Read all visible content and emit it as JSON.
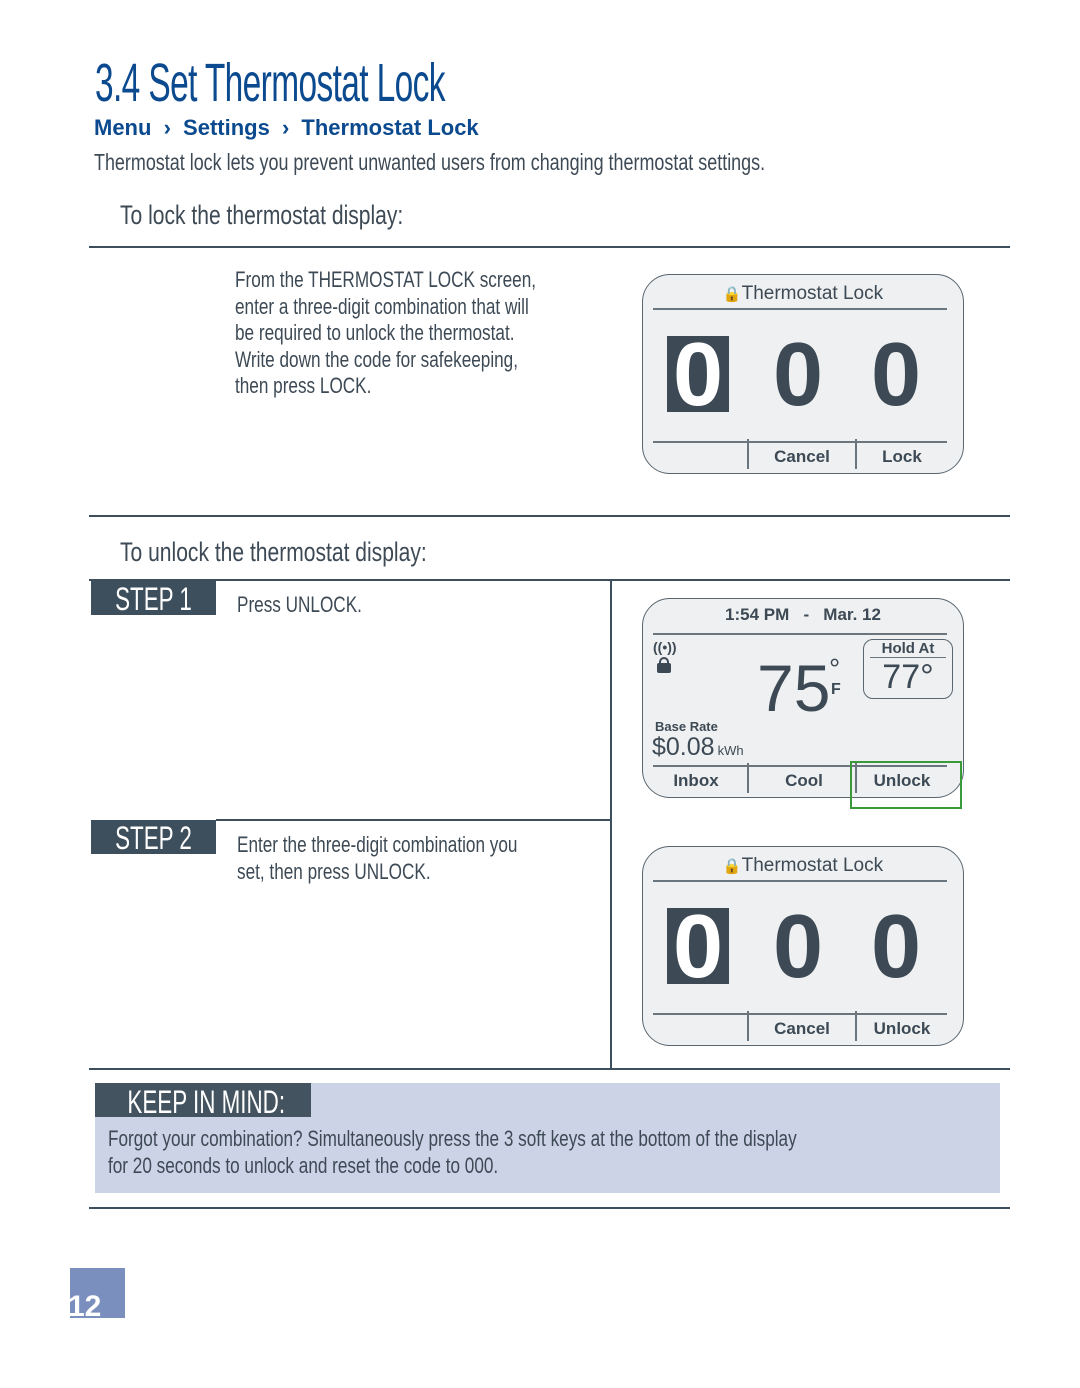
{
  "title": "3.4 Set Thermostat Lock",
  "breadcrumb": [
    "Menu",
    "Settings",
    "Thermostat Lock"
  ],
  "breadcrumb_separator": "›",
  "intro": "Thermostat lock lets you prevent unwanted users from changing thermostat settings.",
  "lock_section": {
    "heading": "To lock the thermostat display:",
    "lines": [
      "From the THERMOSTAT LOCK screen,",
      "enter a three-digit combination that will",
      "be required to unlock the thermostat.",
      "Write down the code for safekeeping,",
      "then press LOCK."
    ],
    "screen": {
      "title": "Thermostat Lock",
      "digits": [
        "0",
        "0",
        "0"
      ],
      "softkeys": [
        "",
        "Cancel",
        "Lock"
      ]
    }
  },
  "unlock_section": {
    "heading": "To unlock the thermostat display:",
    "step1": {
      "label": "STEP 1",
      "text": "Press UNLOCK."
    },
    "step2": {
      "label": "STEP 2",
      "lines": [
        "Enter the three-digit combination you",
        "set, then press UNLOCK."
      ]
    },
    "home_screen": {
      "time": "1:54 PM",
      "separator": "-",
      "date": "Mar. 12",
      "temperature": "75",
      "degree": "°",
      "unit": "F",
      "hold_label": "Hold At",
      "hold_value": "77°",
      "rate_label": "Base Rate",
      "rate_value": "$0.08",
      "rate_unit": "kWh",
      "softkeys": [
        "Inbox",
        "Cool",
        "Unlock"
      ],
      "highlight_color": "#3a9a3a"
    },
    "lock_screen": {
      "title": "Thermostat Lock",
      "digits": [
        "0",
        "0",
        "0"
      ],
      "softkeys": [
        "",
        "Cancel",
        "Unlock"
      ]
    }
  },
  "keep_in_mind": {
    "heading": "KEEP IN MIND:",
    "lines": [
      "Forgot your combination? Simultaneously press the 3 soft keys at the bottom of the display",
      "for 20 seconds to unlock and reset the code to 000."
    ]
  },
  "page_number": "12"
}
